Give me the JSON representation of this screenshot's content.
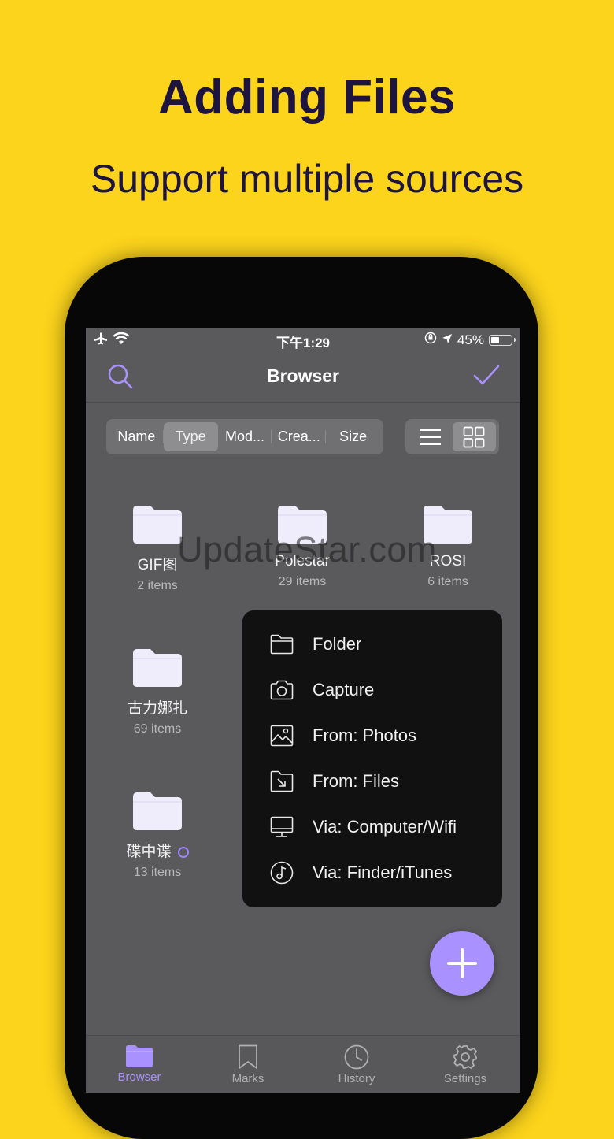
{
  "promo": {
    "headline": "Adding Files",
    "subline": "Support multiple sources"
  },
  "status_bar": {
    "time": "下午1:29",
    "battery": "45%",
    "battery_level": 0.45
  },
  "nav": {
    "title": "Browser"
  },
  "sort": {
    "options": [
      "Name",
      "Type",
      "Mod...",
      "Crea...",
      "Size"
    ],
    "selected": "Type"
  },
  "view_mode": {
    "options": [
      "list",
      "grid"
    ],
    "selected": "grid"
  },
  "folders": [
    {
      "name": "GIF图",
      "count": "2 items"
    },
    {
      "name": "Polestar",
      "count": "29 items"
    },
    {
      "name": "ROSI",
      "count": "6 items"
    },
    {
      "name": "古力娜扎",
      "count": "69 items"
    },
    {
      "name": "碟中谍",
      "count": "13 items"
    }
  ],
  "add_menu": {
    "items": [
      {
        "label": "Folder",
        "icon": "folder-icon"
      },
      {
        "label": "Capture",
        "icon": "camera-icon"
      },
      {
        "label": "From: Photos",
        "icon": "photos-icon"
      },
      {
        "label": "From: Files",
        "icon": "files-import-icon"
      },
      {
        "label": "Via: Computer/Wifi",
        "icon": "monitor-icon"
      },
      {
        "label": "Via: Finder/iTunes",
        "icon": "music-icon"
      }
    ]
  },
  "tabs": [
    {
      "label": "Browser",
      "icon": "folder-icon",
      "active": true
    },
    {
      "label": "Marks",
      "icon": "bookmark-icon",
      "active": false
    },
    {
      "label": "History",
      "icon": "clock-icon",
      "active": false
    },
    {
      "label": "Settings",
      "icon": "gear-icon",
      "active": false
    }
  ],
  "watermark": "UpdateStar.com",
  "colors": {
    "background": "#FCD41C",
    "headline": "#1e1440",
    "accent": "#a992ff",
    "screen": "#5a5a5c",
    "menu": "#111112"
  }
}
